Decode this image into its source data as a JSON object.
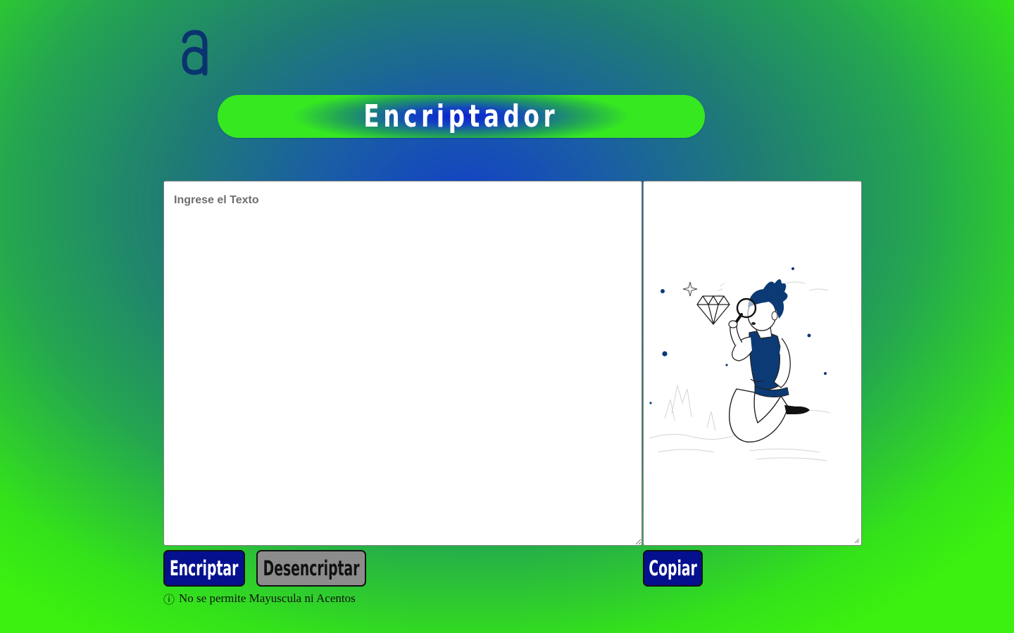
{
  "logo": {
    "icon": "alura-a-logo-icon",
    "color": "#0a3370"
  },
  "header": {
    "title": "Encriptador"
  },
  "input": {
    "placeholder": "Ingrese el Texto",
    "value": ""
  },
  "output": {
    "value": "",
    "illustration": "person-with-magnifying-glass-and-diamond"
  },
  "buttons": {
    "encrypt_label": "Encriptar",
    "decrypt_label": "Desencriptar",
    "copy_label": "Copiar"
  },
  "warning": {
    "icon": "ⓘ",
    "text": "No se permite Mayuscula ni Acentos"
  },
  "colors": {
    "primary_button": "#05108f",
    "secondary_button": "#8c8c8c",
    "background_green": "#3cf010",
    "background_blue": "#1340c8"
  }
}
